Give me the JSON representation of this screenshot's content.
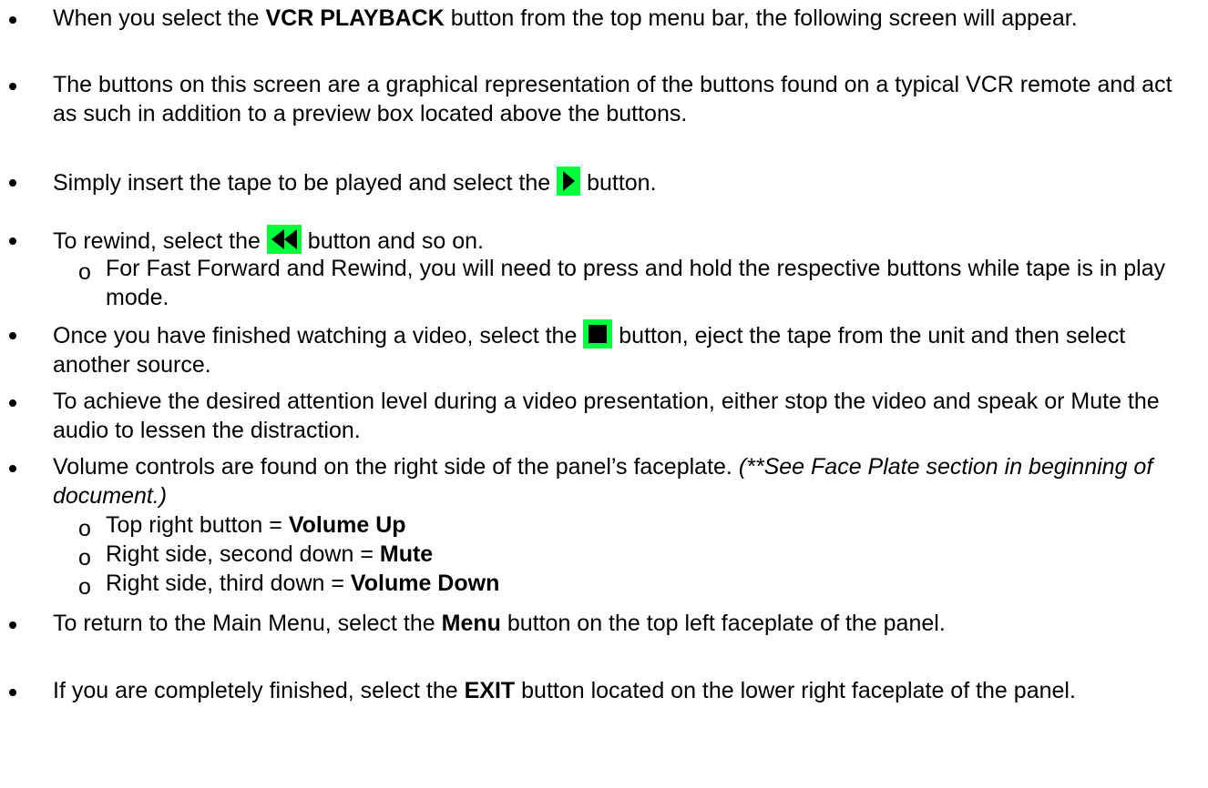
{
  "icons": {
    "play": "play-icon",
    "rewind": "rewind-icon",
    "stop": "stop-icon"
  },
  "accent_color": "#00ff3c",
  "b1": {
    "t1": "When you select the ",
    "t2": "VCR PLAYBACK",
    "t3": " button from the top menu bar, the following screen will appear."
  },
  "b2": {
    "t1": "The buttons on this screen are a graphical representation of the buttons found on a typical VCR remote and act as such in addition to a preview box located above the buttons."
  },
  "b3": {
    "t1": "Simply insert the tape to be played and select the ",
    "t2": " button."
  },
  "b4": {
    "t1": "To rewind, select the ",
    "t2": " button and so on.",
    "sub1": "For Fast Forward and Rewind, you will need to press and hold the respective buttons while tape is in play mode."
  },
  "b5": {
    "t1": "Once you have finished watching a video, select the ",
    "t2": " button, eject the tape from the unit and then select another source."
  },
  "b6": {
    "t1": "To achieve the desired attention level during a video presentation, either stop the video and speak or Mute the audio to lessen the distraction."
  },
  "b7": {
    "t1": "Volume controls are found on the right side of the panel’s faceplate. ",
    "t2": "(**See Face Plate section in beginning of document.)",
    "sub1a": "Top right button = ",
    "sub1b": "Volume Up",
    "sub2a": "Right side, second down = ",
    "sub2b": "Mute",
    "sub3a": "Right side, third down = ",
    "sub3b": "Volume Down"
  },
  "b8": {
    "t1": "To return to the Main Menu, select the ",
    "t2": "Menu",
    "t3": " button on the top left faceplate of the panel."
  },
  "b9": {
    "t1": "If you are completely finished, select the ",
    "t2": "EXIT",
    "t3": " button located on the lower right faceplate of the panel."
  },
  "sub_bullet_glyph": "o"
}
